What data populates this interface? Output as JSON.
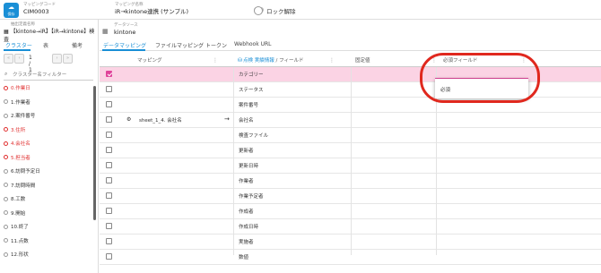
{
  "header": {
    "save_icon": "cloud-save-icon",
    "save_label": "保存",
    "code_caption": "マッピングコード",
    "code_value": "CIM0003",
    "name_caption": "マッピング名称",
    "name_value": "iR→kintone連携 (サンプル)",
    "lock_label": "ロック解除",
    "lock_toggle_on": false
  },
  "sidebar": {
    "source_caption": "抽出定義名称",
    "source_value": "【kintone→iR】【iR→kintone】検査",
    "tabs": [
      "クラスター",
      "表",
      "備考"
    ],
    "active_tab": "クラスター",
    "pager": {
      "first": "«",
      "prev": "‹",
      "text": "1 / 1",
      "next": "›",
      "last": "»"
    },
    "filter_placeholder": "クラスター名フィルター",
    "items": [
      {
        "label": "0.作業日",
        "required": true
      },
      {
        "label": "1.作業者",
        "required": false
      },
      {
        "label": "2.案件番号",
        "required": false
      },
      {
        "label": "3.住所",
        "required": true
      },
      {
        "label": "4.会社名",
        "required": true
      },
      {
        "label": "5.担当者",
        "required": true
      },
      {
        "label": "6.訪問予定日",
        "required": false
      },
      {
        "label": "7.訪問時間",
        "required": false
      },
      {
        "label": "8.工数",
        "required": false
      },
      {
        "label": "9.開始",
        "required": false
      },
      {
        "label": "10.終了",
        "required": false
      },
      {
        "label": "11.点数",
        "required": false
      },
      {
        "label": "12.形状",
        "required": false
      }
    ]
  },
  "main": {
    "datasource_caption": "データソース",
    "datasource_value": "kintone",
    "tabs": [
      "データマッピング",
      "ファイルマッピング",
      "トークン",
      "Webhook URL"
    ],
    "active_tab": "データマッピング",
    "columns": {
      "mapping": "マッピング",
      "source_name": "点検 実績情報",
      "field": "/ フィールド",
      "fixed": "固定値",
      "required": "必須フィールド"
    },
    "rows": [
      {
        "field": "カテゴリー",
        "mapping": "",
        "selected": true,
        "mapped": false
      },
      {
        "field": "ステータス",
        "mapping": "",
        "selected": false,
        "mapped": false
      },
      {
        "field": "案件番号",
        "mapping": "",
        "selected": false,
        "mapped": false
      },
      {
        "field": "会社名",
        "mapping": "sheet_1_4. 会社名",
        "selected": false,
        "mapped": true
      },
      {
        "field": "検査ファイル",
        "mapping": "",
        "selected": false,
        "mapped": false
      },
      {
        "field": "更新者",
        "mapping": "",
        "selected": false,
        "mapped": false
      },
      {
        "field": "更新日時",
        "mapping": "",
        "selected": false,
        "mapped": false
      },
      {
        "field": "作業者",
        "mapping": "",
        "selected": false,
        "mapped": false
      },
      {
        "field": "作業予定者",
        "mapping": "",
        "selected": false,
        "mapped": false
      },
      {
        "field": "作成者",
        "mapping": "",
        "selected": false,
        "mapped": false
      },
      {
        "field": "作成日時",
        "mapping": "",
        "selected": false,
        "mapped": false
      },
      {
        "field": "実施者",
        "mapping": "",
        "selected": false,
        "mapped": false
      },
      {
        "field": "数値",
        "mapping": "",
        "selected": false,
        "mapped": false
      }
    ],
    "dropdown": {
      "value": "",
      "options": [
        "必須"
      ]
    }
  },
  "colors": {
    "accent": "#1a8fd6",
    "selected_row": "#fbd3e4",
    "checkbox_checked": "#e0449a",
    "required_text": "#e03030",
    "annotation_ring": "#e0281e"
  }
}
